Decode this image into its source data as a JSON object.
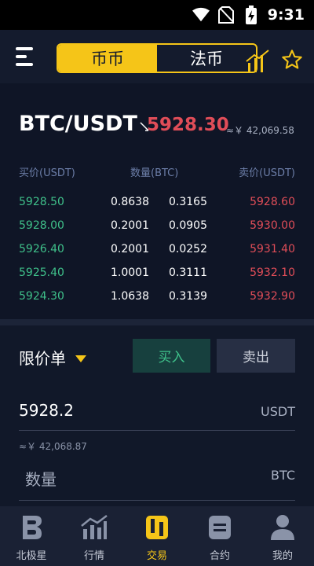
{
  "status_bar": {
    "time": "9:31"
  },
  "header": {
    "tabs": [
      {
        "label": "币币",
        "active": true
      },
      {
        "label": "法币",
        "active": false
      }
    ]
  },
  "ticker": {
    "pair": "BTC/USDT",
    "last_price": "5928.30",
    "cny_price": "≈￥ 42,069.58"
  },
  "orderbook": {
    "headers": {
      "bid": "买价(USDT)",
      "qty": "数量(BTC)",
      "ask": "卖价(USDT)"
    },
    "rows": [
      {
        "bid": "5928.50",
        "bid_qty": "0.8638",
        "ask_qty": "0.3165",
        "ask": "5928.60"
      },
      {
        "bid": "5928.00",
        "bid_qty": "0.2001",
        "ask_qty": "0.0905",
        "ask": "5930.00"
      },
      {
        "bid": "5926.40",
        "bid_qty": "0.2001",
        "ask_qty": "0.0252",
        "ask": "5931.40"
      },
      {
        "bid": "5925.40",
        "bid_qty": "1.0001",
        "ask_qty": "0.3111",
        "ask": "5932.10"
      },
      {
        "bid": "5924.30",
        "bid_qty": "1.0638",
        "ask_qty": "0.3139",
        "ask": "5932.90"
      }
    ]
  },
  "order_form": {
    "order_type": "限价单",
    "buy_label": "买入",
    "sell_label": "卖出",
    "price_value": "5928.2",
    "price_unit": "USDT",
    "price_cny": "≈￥ 42,068.87",
    "qty_placeholder": "数量",
    "qty_unit": "BTC"
  },
  "tabbar": {
    "items": [
      {
        "label": "北极星",
        "icon": "polaris-icon",
        "active": false
      },
      {
        "label": "行情",
        "icon": "market-chart-icon",
        "active": false
      },
      {
        "label": "交易",
        "icon": "trade-icon",
        "active": true
      },
      {
        "label": "合约",
        "icon": "contract-icon",
        "active": false
      },
      {
        "label": "我的",
        "icon": "profile-icon",
        "active": false
      }
    ]
  },
  "colors": {
    "accent": "#f5c518",
    "up": "#3fc08a",
    "down": "#e04d58",
    "background": "#0f1526"
  }
}
